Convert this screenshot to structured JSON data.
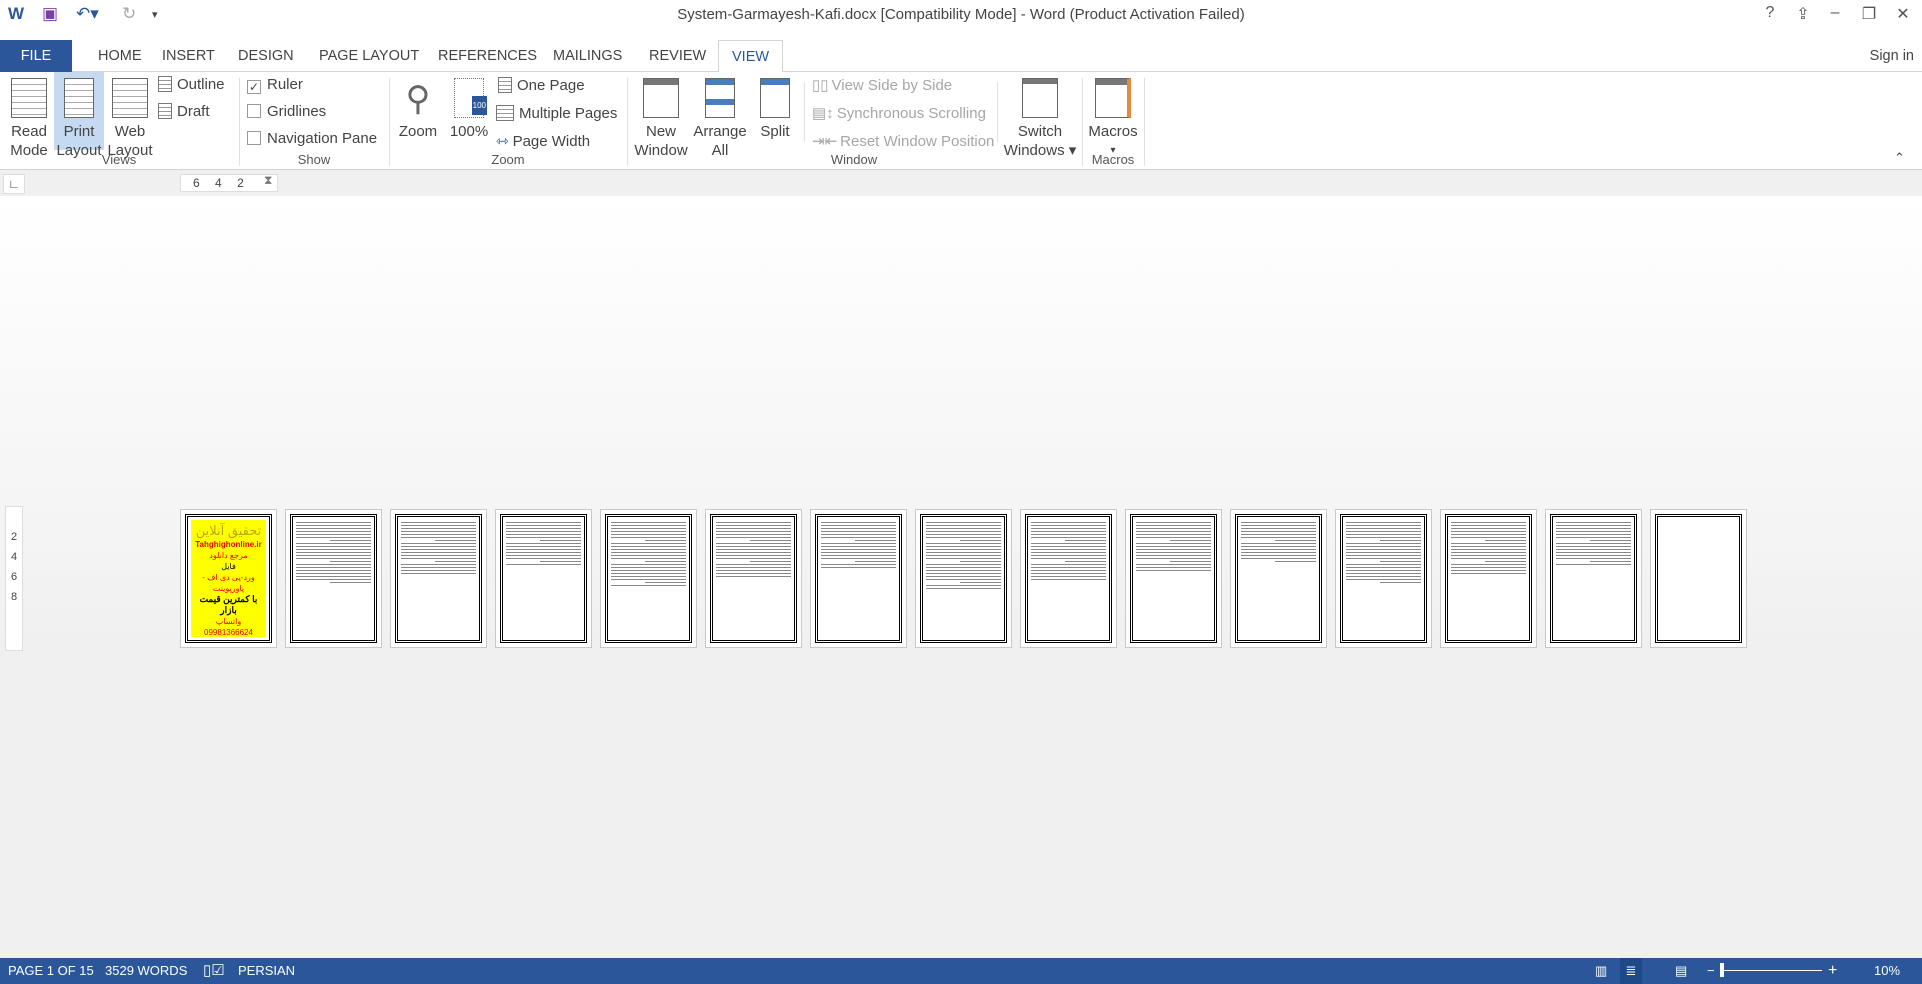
{
  "window": {
    "title": "System-Garmayesh-Kafi.docx [Compatibility Mode] - Word (Product Activation Failed)",
    "help": "?",
    "sign_in": "Sign in"
  },
  "quick_access": {
    "app_icon": "word-icon",
    "save_icon": "save-icon",
    "undo_icon": "undo-icon",
    "redo_icon": "redo-icon"
  },
  "tabs": [
    "FILE",
    "HOME",
    "INSERT",
    "DESIGN",
    "PAGE LAYOUT",
    "REFERENCES",
    "MAILINGS",
    "REVIEW",
    "VIEW"
  ],
  "active_tab": "VIEW",
  "ribbon": {
    "views": {
      "label": "Views",
      "read_mode": "Read Mode",
      "print_layout": "Print Layout",
      "web_layout": "Web Layout",
      "outline": "Outline",
      "draft": "Draft"
    },
    "show": {
      "label": "Show",
      "ruler": "Ruler",
      "ruler_checked": true,
      "gridlines": "Gridlines",
      "gridlines_checked": false,
      "navigation_pane": "Navigation Pane",
      "navigation_pane_checked": false
    },
    "zoom": {
      "label": "Zoom",
      "zoom": "Zoom",
      "hundred": "100%",
      "hundred_badge": "100",
      "one_page": "One Page",
      "multiple_pages": "Multiple Pages",
      "page_width": "Page Width"
    },
    "window": {
      "label": "Window",
      "new_window": "New Window",
      "arrange_all": "Arrange All",
      "split": "Split",
      "view_side_by_side": "View Side by Side",
      "synchronous_scrolling": "Synchronous Scrolling",
      "reset_window_position": "Reset Window Position",
      "switch_windows": "Switch Windows"
    },
    "macros": {
      "label": "Macros",
      "macros": "Macros"
    }
  },
  "ruler": {
    "ticks": [
      "6",
      "4",
      "2"
    ],
    "vertical_ticks": [
      "2",
      "4",
      "6",
      "8"
    ]
  },
  "document": {
    "page_count": 15,
    "cover": {
      "title": "تحقیق آنلاین",
      "site": "Tahghighonline.ir",
      "line1": "مرجع دانلود",
      "line2": "فایل",
      "line3": "ورد-پی دی اف - پاورپوینت",
      "line4": "با کمترین قیمت بازار",
      "phone": "09981366624",
      "whatsapp": "واتساپ"
    }
  },
  "status": {
    "page": "PAGE 1 OF 15",
    "words": "3529 WORDS",
    "language": "PERSIAN",
    "zoom": "10%",
    "zoom_level_percent": 10
  }
}
